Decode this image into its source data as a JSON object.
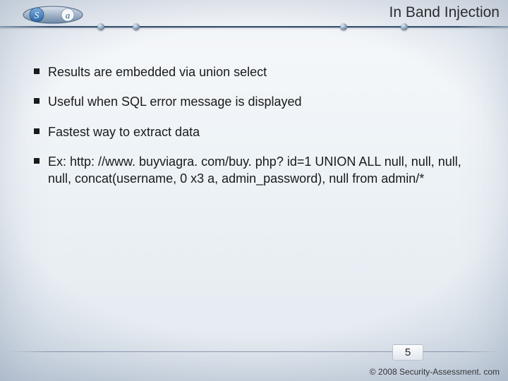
{
  "logo": {
    "left_letter": "S",
    "right_letter": "a"
  },
  "title": "In Band Injection",
  "bullets": [
    "Results are embedded via union select",
    "Useful when SQL error message is displayed",
    "Fastest way to extract data",
    "Ex: http: //www. buyviagra. com/buy. php? id=1 UNION ALL null, null, null, null, concat(username, 0 x3 a, admin_password), null from admin/*"
  ],
  "page_number": "5",
  "copyright": "© 2008 Security-Assessment. com"
}
